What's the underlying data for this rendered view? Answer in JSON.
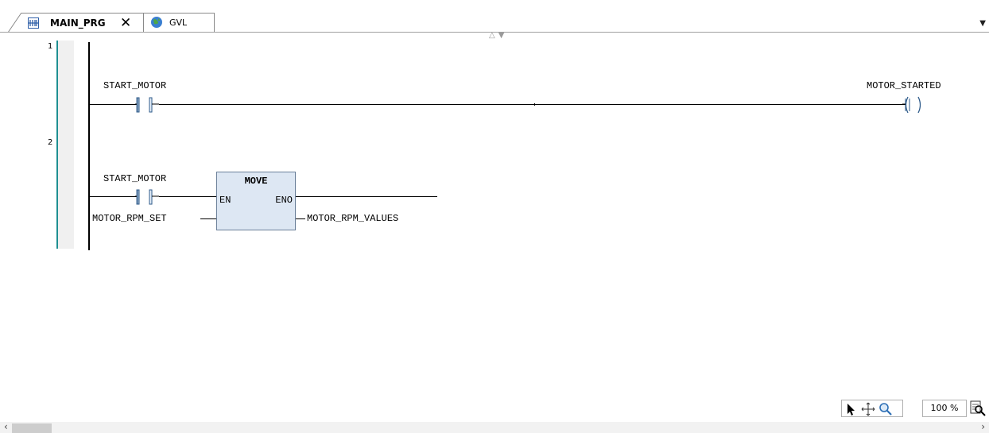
{
  "tabs": [
    {
      "label": "MAIN_PRG",
      "icon": "ladder-pou-icon",
      "active": true
    },
    {
      "label": "GVL",
      "icon": "globe-icon",
      "active": false
    }
  ],
  "editor": {
    "networks": [
      {
        "number": "1",
        "contact_label": "START_MOTOR",
        "coil_label": "MOTOR_STARTED"
      },
      {
        "number": "2",
        "contact_label": "START_MOTOR",
        "block": {
          "name": "MOVE",
          "en_label": "EN",
          "eno_label": "ENO",
          "input_label": "MOTOR_RPM_SET",
          "output_label": "MOTOR_RPM_VALUES"
        }
      }
    ]
  },
  "toolbar": {
    "zoom": "100 %"
  },
  "colors": {
    "gutter_accent": "#1e8f92",
    "block_fill": "#dde7f3"
  }
}
